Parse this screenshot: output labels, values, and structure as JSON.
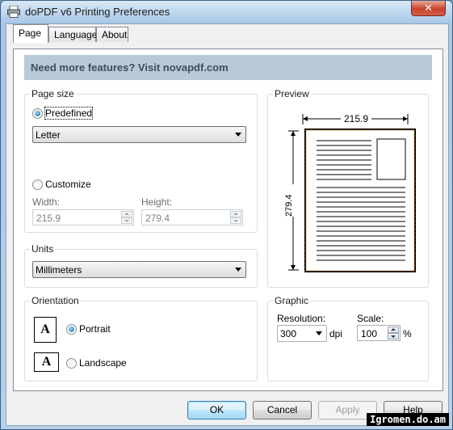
{
  "window": {
    "title": "doPDF v6 Printing Preferences",
    "close_glyph": "✕",
    "icon": "printer-icon"
  },
  "tabs": [
    {
      "label": "Page",
      "active": true
    },
    {
      "label": "Language",
      "active": false
    },
    {
      "label": "About",
      "active": false
    }
  ],
  "banner": {
    "text": "Need more features? Visit novapdf.com"
  },
  "page_size": {
    "group_label": "Page size",
    "predefined_label": "Predefined",
    "predefined_checked": true,
    "paper_value": "Letter",
    "customize_label": "Customize",
    "customize_checked": false,
    "width_label": "Width:",
    "width_value": "215.9",
    "height_label": "Height:",
    "height_value": "279.4"
  },
  "units": {
    "group_label": "Units",
    "value": "Millimeters"
  },
  "orientation": {
    "group_label": "Orientation",
    "portrait_label": "Portrait",
    "portrait_checked": true,
    "landscape_label": "Landscape",
    "landscape_checked": false,
    "icon_glyph": "A"
  },
  "preview": {
    "group_label": "Preview",
    "width_text": "215.9",
    "height_text": "279.4"
  },
  "graphic": {
    "group_label": "Graphic",
    "resolution_label": "Resolution:",
    "resolution_value": "300",
    "resolution_unit": "dpi",
    "scale_label": "Scale:",
    "scale_value": "100",
    "scale_unit": "%"
  },
  "buttons": {
    "ok": "OK",
    "cancel": "Cancel",
    "apply": "Apply",
    "help": "Help"
  },
  "watermark": "Igromen.do.am",
  "colors": {
    "banner_bg": "#b9c9d8",
    "banner_text": "#3e4e5e",
    "default_button": "#3c7fb1"
  }
}
